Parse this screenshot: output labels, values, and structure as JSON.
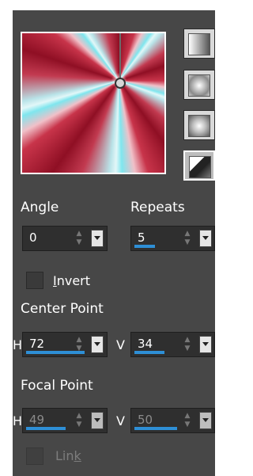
{
  "preview": {
    "colors": [
      "#8f0f24",
      "#c8344a",
      "#7fe6ee",
      "#e2f7f8"
    ]
  },
  "style_buttons": [
    {
      "name": "linear-style",
      "icon": "linear-gradient-icon"
    },
    {
      "name": "rectangular-style",
      "icon": "rectangular-gradient-icon"
    },
    {
      "name": "sunburst-style",
      "icon": "sunburst-gradient-icon"
    },
    {
      "name": "radial-style",
      "icon": "radial-gradient-icon",
      "selected": true
    }
  ],
  "angle": {
    "label": "Angle",
    "value": "0"
  },
  "repeats": {
    "label": "Repeats",
    "value": "5"
  },
  "invert": {
    "label": "Invert",
    "underline_char": "I",
    "rest": "nvert",
    "checked": false
  },
  "center_point": {
    "label": "Center Point",
    "h_label": "H",
    "h_value": "72",
    "v_label": "V",
    "v_value": "34"
  },
  "focal_point": {
    "label": "Focal Point",
    "h_label": "H",
    "h_value": "49",
    "v_label": "V",
    "v_value": "50",
    "disabled": true
  },
  "link": {
    "label": "Link",
    "pre": "Lin",
    "underline_char": "k",
    "checked": false,
    "disabled": true
  },
  "accent_color": "#2e8fd6"
}
